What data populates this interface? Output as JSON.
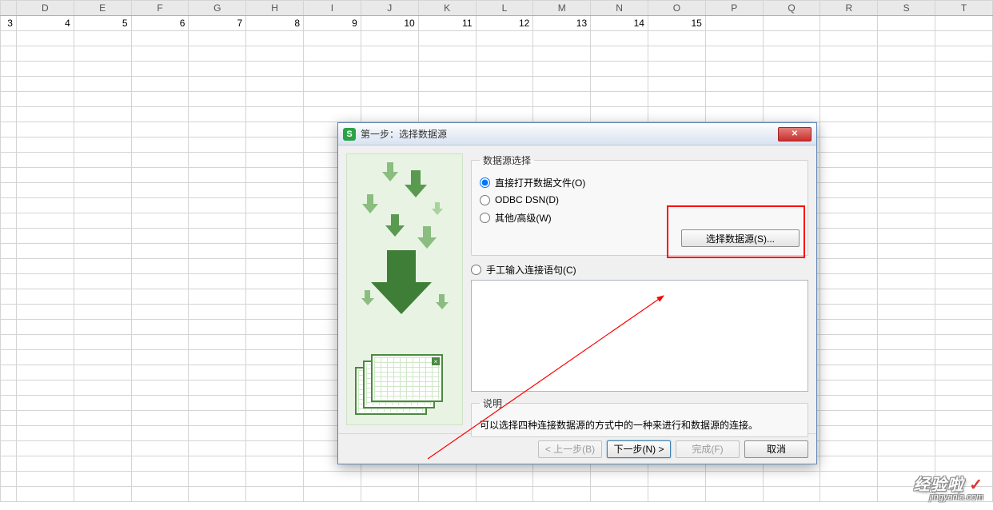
{
  "sheet": {
    "columns": [
      "D",
      "E",
      "F",
      "G",
      "H",
      "I",
      "J",
      "K",
      "L",
      "M",
      "N",
      "O",
      "P",
      "Q",
      "R",
      "S",
      "T"
    ],
    "row1": [
      "3",
      "4",
      "5",
      "6",
      "7",
      "8",
      "9",
      "10",
      "11",
      "12",
      "13",
      "14",
      "15",
      "",
      "",
      "",
      ""
    ]
  },
  "dialog": {
    "title": "第一步：选择数据源",
    "app_icon_letter": "S",
    "close_symbol": "✕",
    "group_source": {
      "legend": "数据源选择",
      "opt_direct": "直接打开数据文件(O)",
      "opt_odbc": "ODBC DSN(D)",
      "opt_other": "其他/高级(W)",
      "btn_select": "选择数据源(S)..."
    },
    "group_conn": {
      "radio_label": "手工输入连接语句(C)"
    },
    "group_desc": {
      "legend": "说明",
      "text": "可以选择四种连接数据源的方式中的一种来进行和数据源的连接。"
    },
    "footer": {
      "back": "< 上一步(B)",
      "next": "下一步(N) >",
      "finish": "完成(F)",
      "cancel": "取消"
    }
  },
  "watermark": {
    "line1": "经验啦",
    "check": "✓",
    "line2": "jingyanla.com"
  }
}
